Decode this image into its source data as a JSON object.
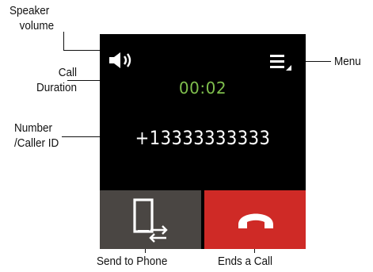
{
  "callouts": {
    "speaker_volume": [
      "Speaker",
      "volume"
    ],
    "call_duration": [
      "Call",
      "Duration"
    ],
    "number_caller_id": [
      "Number",
      "/Caller ID"
    ],
    "menu": "Menu",
    "send_to_phone": "Send to Phone",
    "ends_a_call": "Ends a Call"
  },
  "screen": {
    "duration": "00:02",
    "number": "+13333333333"
  },
  "icons": {
    "speaker": "speaker-volume-icon",
    "menu": "menu-icon",
    "send": "send-to-phone-icon",
    "end": "end-call-icon"
  },
  "colors": {
    "duration_text": "#7fbf4d",
    "send_button": "#4a4643",
    "end_button": "#cf2a26",
    "screen_bg": "#000000"
  }
}
